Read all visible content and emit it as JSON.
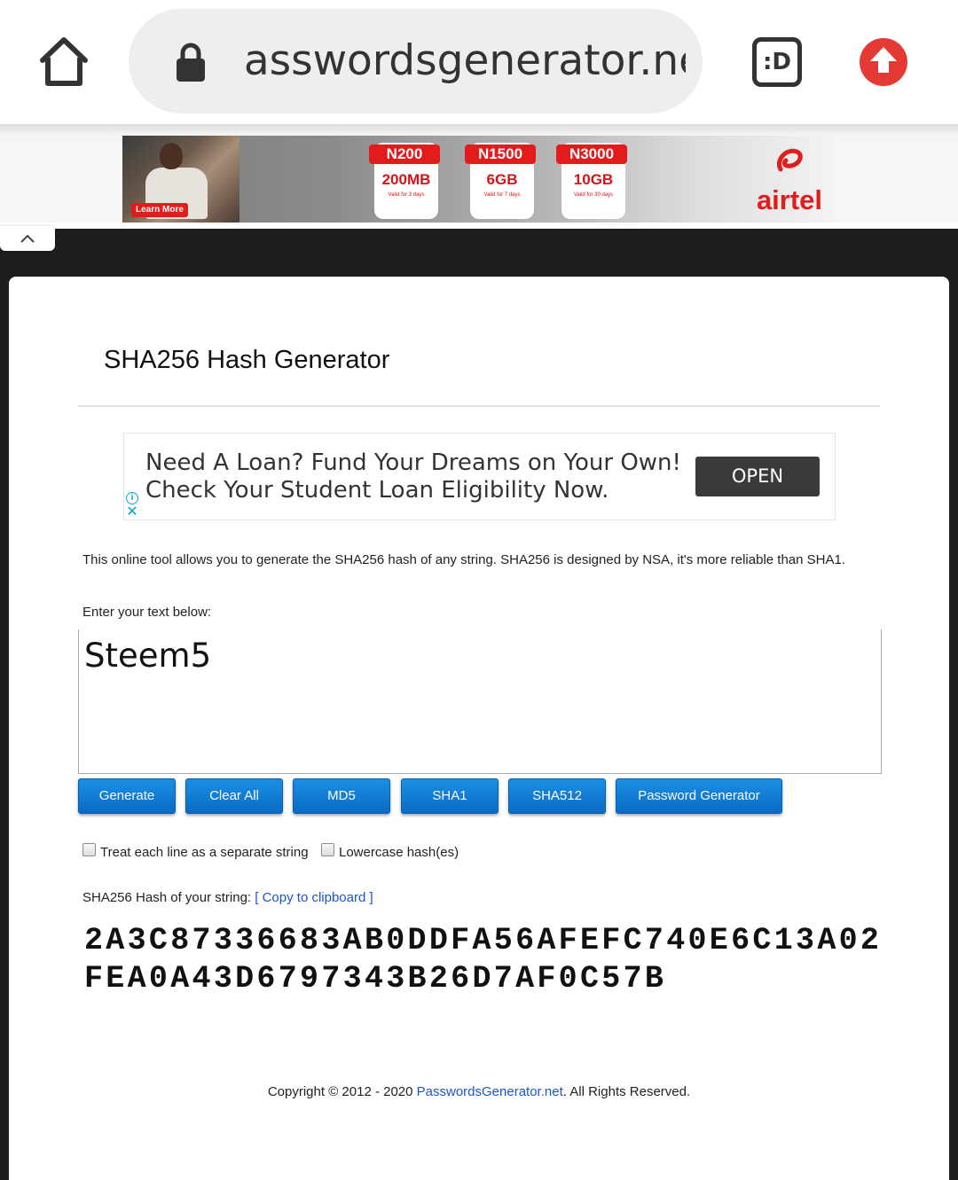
{
  "browser": {
    "url": "passwordsgenerator.net",
    "tab_switcher_label": ":D"
  },
  "top_ad": {
    "learn_more": "Learn More",
    "brand": "airtel",
    "brand_color": "#e21b1b",
    "plans": [
      {
        "price": "N200",
        "data": "200MB",
        "valid": "Valid for 3 days"
      },
      {
        "price": "N1500",
        "data": "6GB",
        "valid": "Valid for 7 days"
      },
      {
        "price": "N3000",
        "data": "10GB",
        "valid": "Valid for 30 days"
      }
    ]
  },
  "page": {
    "title": "SHA256 Hash Generator",
    "description": "This online tool allows you to generate the SHA256 hash of any string. SHA256 is designed by NSA, it's more reliable than SHA1.",
    "input_label": "Enter your text below:",
    "input_value": "Steem5"
  },
  "loan_ad": {
    "line1": "Need A Loan? Fund Your Dreams on Your Own!",
    "line2": "Check Your Student Loan Eligibility Now.",
    "cta": "OPEN"
  },
  "buttons": {
    "generate": "Generate",
    "clear_all": "Clear All",
    "md5": "MD5",
    "sha1": "SHA1",
    "sha512": "SHA512",
    "password_generator": "Password Generator"
  },
  "options": {
    "separate_lines": "Treat each line as a separate string",
    "lowercase": "Lowercase hash(es)"
  },
  "result": {
    "label": "SHA256 Hash of your string:",
    "copy": "[ Copy to clipboard ]",
    "hash": "2A3C87336683AB0DDFA56AFEFC740E6C13A02FEA0A43D6797343B26D7AF0C57B"
  },
  "footer": {
    "prefix": "Copyright © 2012 - 2020 ",
    "link": "PasswordsGenerator.net",
    "suffix": ". All Rights Reserved."
  },
  "colors": {
    "button_blue": "#0a6bc4",
    "link_blue": "#1a55cc",
    "upload_red": "#e53935",
    "dark_band": "#1e1e1e"
  }
}
